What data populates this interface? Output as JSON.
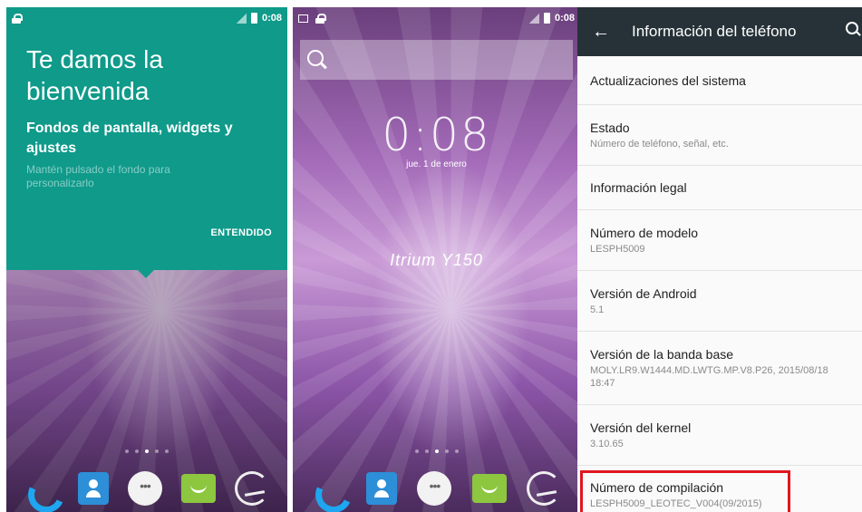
{
  "status": {
    "time": "0:08"
  },
  "phone1": {
    "welcome_title": "Te damos la bienvenida",
    "welcome_subtitle": "Fondos de pantalla, widgets y ajustes",
    "welcome_desc": "Mantén pulsado el fondo para personalizarlo",
    "ok_button": "ENTENDIDO"
  },
  "phone2": {
    "clock": "0:08",
    "date": "jue. 1 de enero",
    "brand": "Itrium Y150"
  },
  "phone3": {
    "toolbar_title": "Información del teléfono",
    "items": [
      {
        "primary": "Actualizaciones del sistema",
        "secondary": ""
      },
      {
        "primary": "Estado",
        "secondary": "Número de teléfono, señal, etc."
      },
      {
        "primary": "Información legal",
        "secondary": ""
      },
      {
        "primary": "Número de modelo",
        "secondary": "LESPH5009"
      },
      {
        "primary": "Versión de Android",
        "secondary": "5.1"
      },
      {
        "primary": "Versión de la banda base",
        "secondary": "MOLY.LR9.W1444.MD.LWTG.MP.V8.P26, 2015/08/18 18:47"
      },
      {
        "primary": "Versión del kernel",
        "secondary": "3.10.65"
      },
      {
        "primary": "Número de compilación",
        "secondary": "LESPH5009_LEOTEC_V004(09/2015)"
      }
    ]
  },
  "colors": {
    "teal": "#0f9a8a",
    "toolbar": "#263238",
    "highlight": "#e0161f"
  },
  "icons": [
    "lock-icon",
    "phone-app-icon",
    "contacts-icon",
    "apps-icon",
    "messaging-icon",
    "browser-icon",
    "search-icon",
    "back-arrow-icon"
  ]
}
